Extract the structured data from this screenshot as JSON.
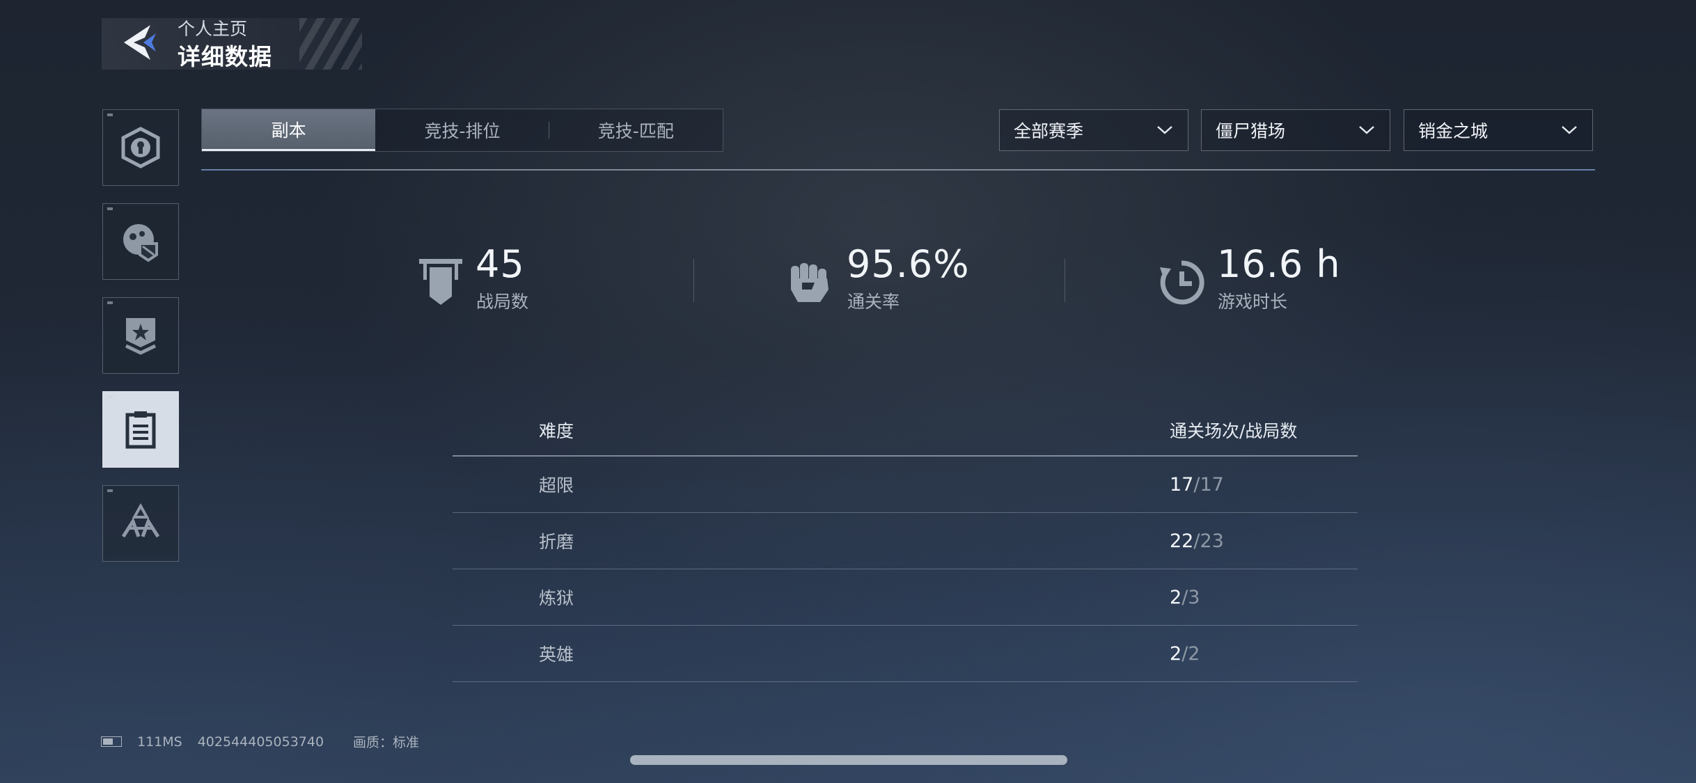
{
  "header": {
    "subtitle": "个人主页",
    "title": "详细数据"
  },
  "sidebar": {
    "items": [
      {
        "icon": "keyhole-badge-icon",
        "active": false
      },
      {
        "icon": "skull-shield-icon",
        "active": false
      },
      {
        "icon": "star-rank-icon",
        "active": false
      },
      {
        "icon": "clipboard-icon",
        "active": true
      },
      {
        "icon": "emblem-logo-icon",
        "active": false
      }
    ]
  },
  "tabs": [
    {
      "label": "副本",
      "active": true
    },
    {
      "label": "竞技-排位",
      "active": false
    },
    {
      "label": "竞技-匹配",
      "active": false
    }
  ],
  "filters": {
    "season": "全部赛季",
    "mode": "僵尸猎场",
    "map": "销金之城"
  },
  "stats": [
    {
      "icon": "banner-icon",
      "value": "45",
      "label": "战局数"
    },
    {
      "icon": "fist-icon",
      "value": "95.6%",
      "label": "通关率"
    },
    {
      "icon": "clock-icon",
      "value": "16.6 h",
      "label": "游戏时长"
    }
  ],
  "table": {
    "headers": {
      "difficulty": "难度",
      "ratio": "通关场次/战局数"
    },
    "rows": [
      {
        "difficulty": "超限",
        "cleared": "17",
        "total": "/17"
      },
      {
        "difficulty": "折磨",
        "cleared": "22",
        "total": "/23"
      },
      {
        "difficulty": "炼狱",
        "cleared": "2",
        "total": "/3"
      },
      {
        "difficulty": "英雄",
        "cleared": "2",
        "total": "/2"
      }
    ]
  },
  "footer": {
    "ping": "111MS",
    "uid": "402544405053740",
    "quality": "画质：标准"
  },
  "colors": {
    "accent": "#4f7be0",
    "active_tab": "#5f6a78",
    "active_side": "#d7dde6"
  }
}
